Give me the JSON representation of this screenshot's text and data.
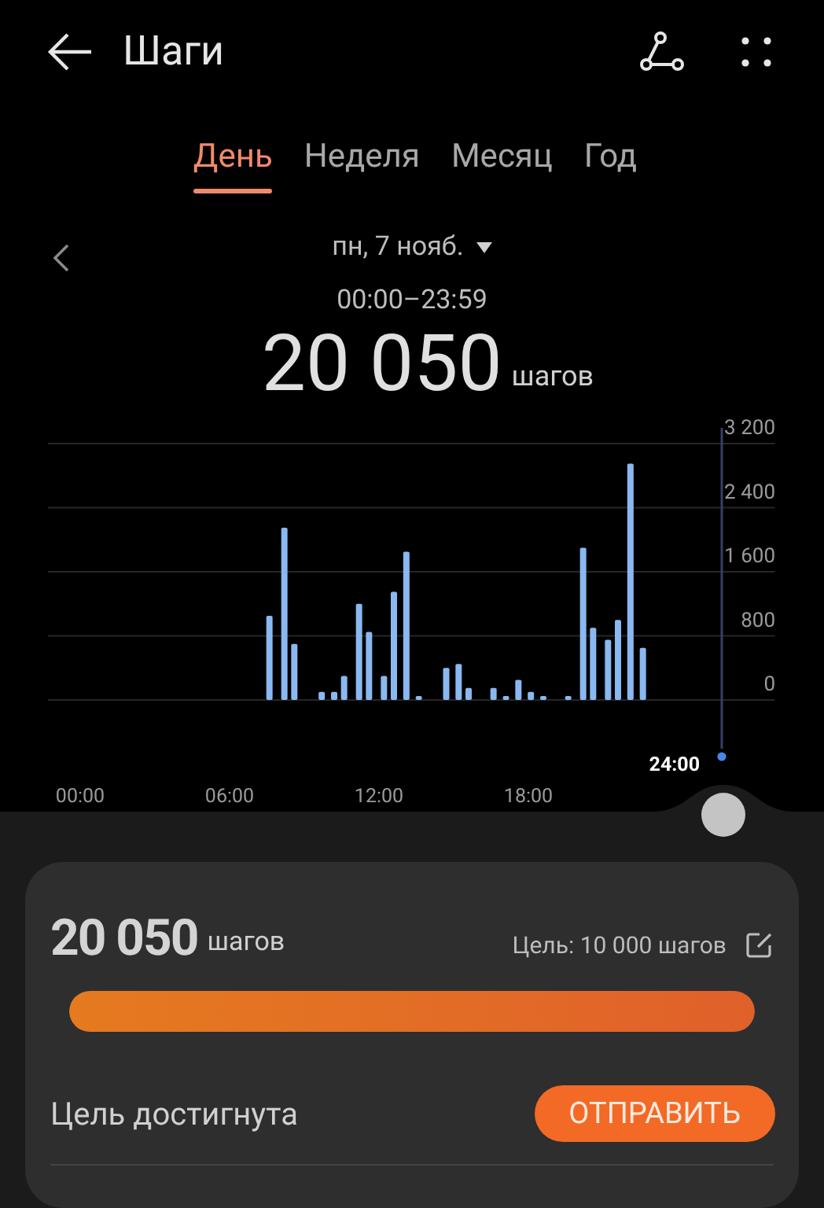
{
  "header": {
    "title": "Шаги"
  },
  "tabs": [
    {
      "label": "День",
      "selected": true
    },
    {
      "label": "Неделя",
      "selected": false
    },
    {
      "label": "Месяц",
      "selected": false
    },
    {
      "label": "Год",
      "selected": false
    }
  ],
  "date": {
    "label": "пн, 7 нояб."
  },
  "time_range": "00:00–23:59",
  "total": {
    "value": "20 050",
    "unit": "шагов"
  },
  "chart": {
    "cursor_label": "24:00",
    "chart_data": {
      "type": "bar",
      "grid": true,
      "x": [
        7.6,
        8.2,
        8.6,
        9.7,
        10.2,
        10.6,
        11.2,
        11.6,
        12.2,
        12.6,
        13.1,
        13.6,
        14.7,
        15.2,
        15.6,
        16.6,
        17.1,
        17.6,
        18.1,
        18.6,
        19.6,
        20.2,
        20.6,
        21.2,
        21.6,
        22.1,
        22.6
      ],
      "series": [
        {
          "color": "#8ab8f0",
          "values": [
            1050,
            2150,
            700,
            100,
            100,
            300,
            1200,
            850,
            300,
            1350,
            1850,
            50,
            400,
            450,
            150,
            150,
            50,
            250,
            100,
            50,
            50,
            1900,
            900,
            750,
            1000,
            2950,
            650
          ]
        }
      ],
      "xlim": [
        -1.3,
        27.9
      ],
      "ylim": [
        0,
        3200
      ],
      "xticks": [
        {
          "value": 0,
          "label": "00:00"
        },
        {
          "value": 6,
          "label": "06:00"
        },
        {
          "value": 12,
          "label": "12:00"
        },
        {
          "value": 18,
          "label": "18:00"
        }
      ],
      "yticks": [
        {
          "value": 0,
          "label": "0"
        },
        {
          "value": 800,
          "label": "800"
        },
        {
          "value": 1600,
          "label": "1 600"
        },
        {
          "value": 2400,
          "label": "2 400"
        },
        {
          "value": 3200,
          "label": "3 200"
        }
      ]
    }
  },
  "summary": {
    "value": "20 050",
    "unit": "шагов",
    "goal": "Цель: 10 000 шагов",
    "level": 1,
    "status": "Цель достигнута",
    "button": "ОТПРАВИТЬ"
  }
}
